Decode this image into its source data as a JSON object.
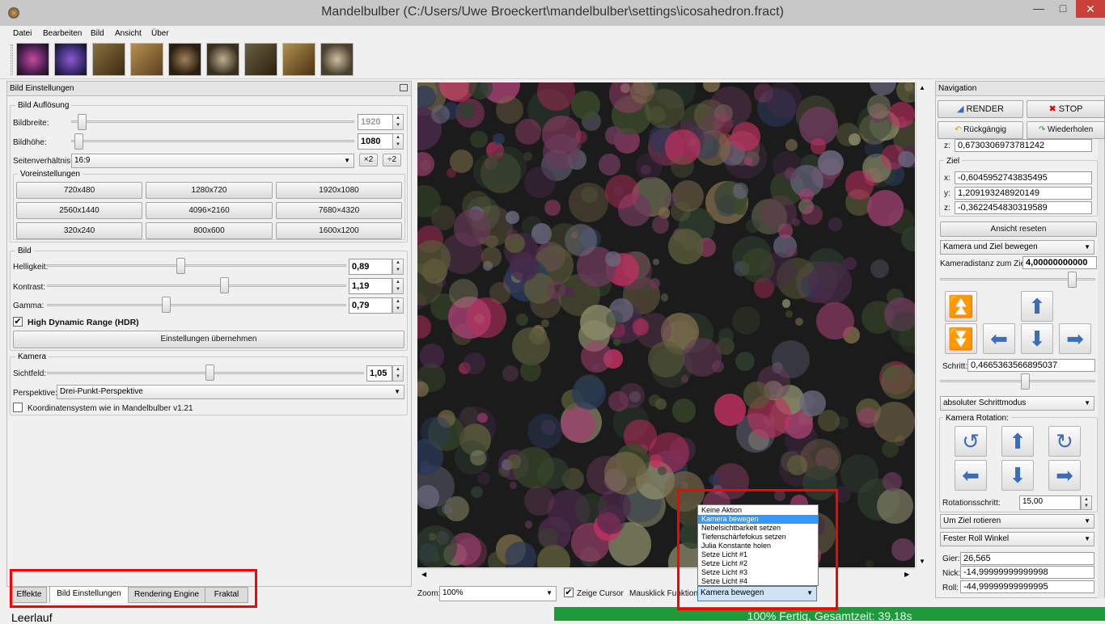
{
  "window": {
    "title": "Mandelbulber (C:/Users/Uwe Broeckert\\mandelbulber\\settings\\icosahedron.fract)"
  },
  "menu": [
    "Datei",
    "Bearbeiten",
    "Bild",
    "Ansicht",
    "Über"
  ],
  "left_panel": {
    "title": "Bild Einstellungen",
    "resolution": {
      "title": "Bild Auflösung",
      "width_label": "Bildbreite:",
      "width_value": "1920",
      "height_label": "Bildhöhe:",
      "height_value": "1080",
      "aspect_label": "Seitenverhältnis:",
      "aspect_value": "16:9",
      "x2": "×2",
      "div2": "÷2"
    },
    "presets": {
      "title": "Voreinstellungen",
      "buttons": [
        "720x480",
        "1280x720",
        "1920x1080",
        "2560x1440",
        "4096×2160",
        "7680×4320",
        "320x240",
        "800x600",
        "1600x1200"
      ]
    },
    "image": {
      "title": "Bild",
      "brightness_label": "Helligkeit:",
      "brightness_value": "0,89",
      "contrast_label": "Kontrast:",
      "contrast_value": "1,19",
      "gamma_label": "Gamma:",
      "gamma_value": "0,79",
      "hdr_label": "High Dynamic Range (HDR)",
      "hdr_checked": true,
      "apply_button": "Einstellungen übernehmen"
    },
    "camera": {
      "title": "Kamera",
      "fov_label": "Sichtfeld:",
      "fov_value": "1,05",
      "perspective_label": "Perspektive:",
      "perspective_value": "Drei-Punkt-Perspektive",
      "coord_label": "Koordinatensystem wie in Mandelbulber v1.21"
    },
    "tabs": [
      "Effekte",
      "Bild Einstellungen",
      "Rendering Engine",
      "Fraktal"
    ],
    "active_tab": "Bild Einstellungen"
  },
  "status": {
    "left": "Leerlauf",
    "progress_text": "100% Fertig, Gesamtzeit: 39,18s",
    "progress": 1.0
  },
  "bottom_bar": {
    "zoom_label": "Zoom:",
    "zoom_value": "100%",
    "show_cursor_label": "Zeige Cursor",
    "mouse_fn_label": "Mausklick Funktion:",
    "mouse_fn_value": "Kamera bewegen",
    "dropdown_options": [
      "Keine Aktion",
      "Kamera bewegen",
      "Nebelsichtbarkeit setzen",
      "Tiefenschärfefokus setzen",
      "Julia Konstante holen",
      "Setze Licht #1",
      "Setze Licht #2",
      "Setze Licht #3",
      "Setze Licht #4"
    ],
    "dropdown_selected_index": 1
  },
  "nav": {
    "title": "Navigation",
    "render": "RENDER",
    "stop": "STOP",
    "undo": "Rückgängig",
    "redo": "Wiederholen",
    "z_label": "z:",
    "z_value": "0,6730306973781242",
    "target_title": "Ziel",
    "target_x_label": "x:",
    "target_x": "-0,6045952743835495",
    "target_y_label": "y:",
    "target_y": "1,209193248920149",
    "target_z_label": "z:",
    "target_z": "-0,3622454830319589",
    "reset_view": "Ansicht reseten",
    "move_mode": "Kamera und Ziel bewegen",
    "distance_label": "Kameradistanz zum Ziel:",
    "distance_value": "4,00000000000",
    "step_label": "Schritt:",
    "step_value": "0,4665363566895037",
    "step_mode": "absoluter Schrittmodus",
    "rotation_title": "Kamera Rotation:",
    "rot_step_label": "Rotationsschritt:",
    "rot_step_value": "15,00",
    "rotate_around": "Um Ziel rotieren",
    "roll_mode": "Fester Roll Winkel",
    "yaw_label": "Gier:",
    "yaw_value": "26,565",
    "pitch_label": "Nick:",
    "pitch_value": "-14,99999999999998",
    "roll_label": "Roll:",
    "roll_value": "-44,99999999999995"
  },
  "colors": {
    "accent": "#3399ff",
    "progress": "#1f9a3a",
    "highlight": "#ff0000"
  }
}
